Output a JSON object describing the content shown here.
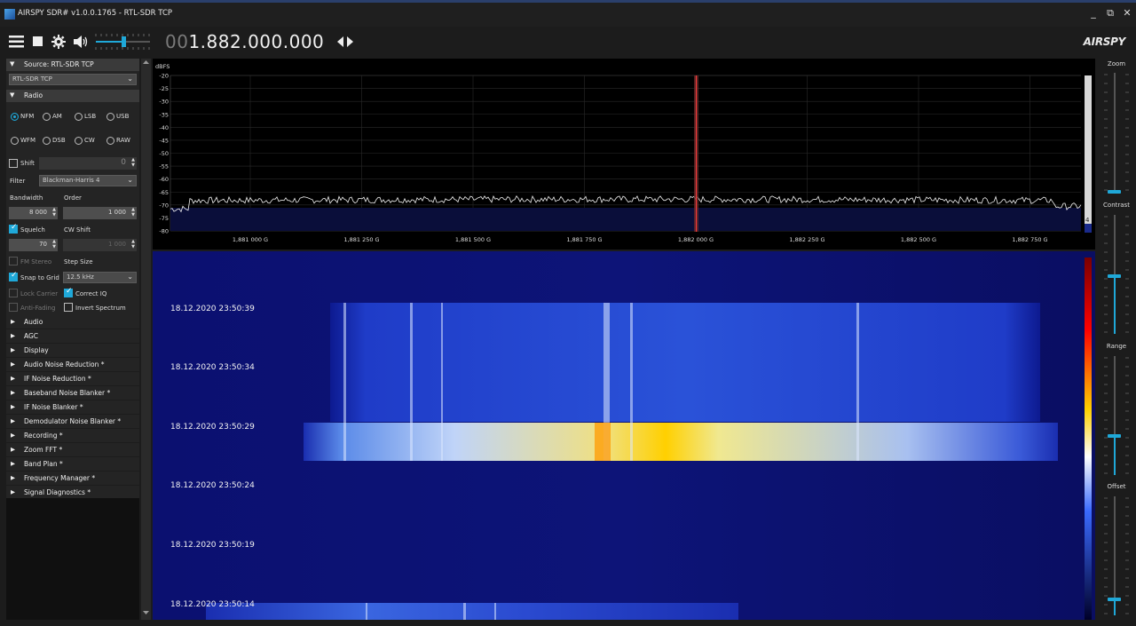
{
  "window": {
    "title": "AIRSPY SDR# v1.0.0.1765 - RTL-SDR TCP",
    "minimize": "_",
    "maximize": "⧉",
    "close": "✕"
  },
  "toolbar": {
    "freq_prefix": "00",
    "freq_main": "1.882.000.000",
    "brand": "AIRSPY"
  },
  "source": {
    "header": "Source: RTL-SDR TCP",
    "device": "RTL-SDR TCP"
  },
  "radio": {
    "header": "Radio",
    "modes": [
      "NFM",
      "AM",
      "LSB",
      "USB",
      "WFM",
      "DSB",
      "CW",
      "RAW"
    ],
    "selected_mode": "NFM",
    "shift_label": "Shift",
    "shift_value": "0",
    "filter_label": "Filter",
    "filter_value": "Blackman-Harris 4",
    "bandwidth_label": "Bandwidth",
    "bandwidth_value": "8 000",
    "order_label": "Order",
    "order_value": "1 000",
    "squelch_label": "Squelch",
    "squelch_value": "70",
    "cwshift_label": "CW Shift",
    "cwshift_value": "1 000",
    "fmstereo_label": "FM Stereo",
    "stepsize_label": "Step Size",
    "snap_label": "Snap to Grid",
    "stepsize_value": "12.5 kHz",
    "lockcarrier_label": "Lock Carrier",
    "correctiq_label": "Correct IQ",
    "antifading_label": "Anti-Fading",
    "invert_label": "Invert Spectrum"
  },
  "plugins": [
    "Audio",
    "AGC",
    "Display",
    "Audio Noise Reduction *",
    "IF Noise Reduction *",
    "Baseband Noise Blanker *",
    "IF Noise Blanker *",
    "Demodulator Noise Blanker *",
    "Recording *",
    "Zoom FFT *",
    "Band Plan *",
    "Frequency Manager *",
    "Signal Diagnostics *"
  ],
  "spectrum": {
    "unit": "dBFS",
    "y_labels": [
      "-20",
      "-25",
      "-30",
      "-35",
      "-40",
      "-45",
      "-50",
      "-55",
      "-60",
      "-65",
      "-70",
      "-75",
      "-80"
    ],
    "x_labels": [
      "1,881 000 G",
      "1,881 250 G",
      "1,881 500 G",
      "1,881 750 G",
      "1,882 000 G",
      "1,882 250 G",
      "1,882 500 G",
      "1,882 750 G"
    ],
    "scroll_value": "4"
  },
  "waterfall": {
    "timestamps": [
      "18.12.2020 23:50:39",
      "18.12.2020 23:50:34",
      "18.12.2020 23:50:29",
      "18.12.2020 23:50:24",
      "18.12.2020 23:50:19",
      "18.12.2020 23:50:14"
    ]
  },
  "sliders": {
    "zoom": "Zoom",
    "contrast": "Contrast",
    "range": "Range",
    "offset": "Offset"
  },
  "colors": {
    "accent": "#1fa8d8",
    "panel": "#242424",
    "header": "#3a3a3a",
    "waterfall_bg": "#0a0e60"
  }
}
